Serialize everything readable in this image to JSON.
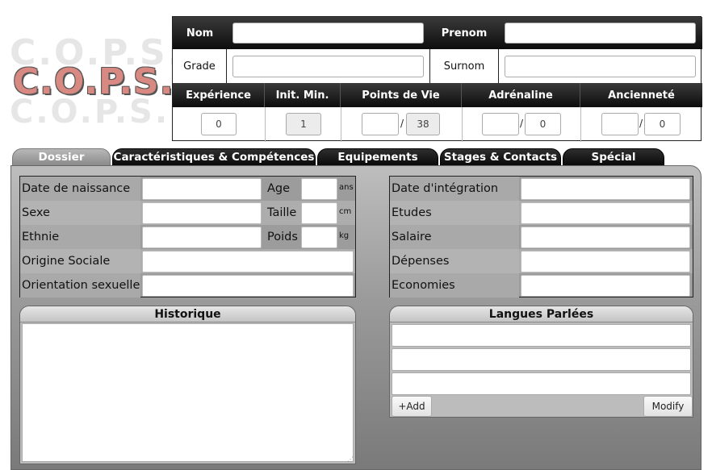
{
  "logo": {
    "text": "C.O.P.S."
  },
  "header": {
    "nom_label": "Nom",
    "prenom_label": "Prenom",
    "grade_label": "Grade",
    "surnom_label": "Surnom",
    "stats": {
      "experience": {
        "label": "Expérience",
        "value": "0"
      },
      "init_min": {
        "label": "Init. Min.",
        "value": "1"
      },
      "points_de_vie": {
        "label": "Points de Vie",
        "current": "",
        "max": "38"
      },
      "adrenaline": {
        "label": "Adrénaline",
        "current": "",
        "max": "0"
      },
      "anciennete": {
        "label": "Ancienneté",
        "current": "",
        "max": "0"
      }
    },
    "slash": "/"
  },
  "tabs": [
    "Dossier",
    "Caractéristiques & Compétences",
    "Equipements",
    "Stages & Contacts",
    "Spécial"
  ],
  "dossier": {
    "left_fields": {
      "date_naissance": "Date de naissance",
      "sexe": "Sexe",
      "ethnie": "Ethnie",
      "origine_sociale": "Origine Sociale",
      "orientation_sexuelle": "Orientation sexuelle",
      "age": "Age",
      "taille": "Taille",
      "poids": "Poids",
      "age_unit": "ans",
      "taille_unit": "cm",
      "poids_unit": "kg"
    },
    "right_fields": {
      "date_integration": "Date d'intégration",
      "etudes": "Etudes",
      "salaire": "Salaire",
      "depenses": "Dépenses",
      "economies": "Economies"
    },
    "historique_title": "Historique",
    "langues_title": "Langues Parlées",
    "add_label": "+Add",
    "modify_label": "Modify"
  }
}
